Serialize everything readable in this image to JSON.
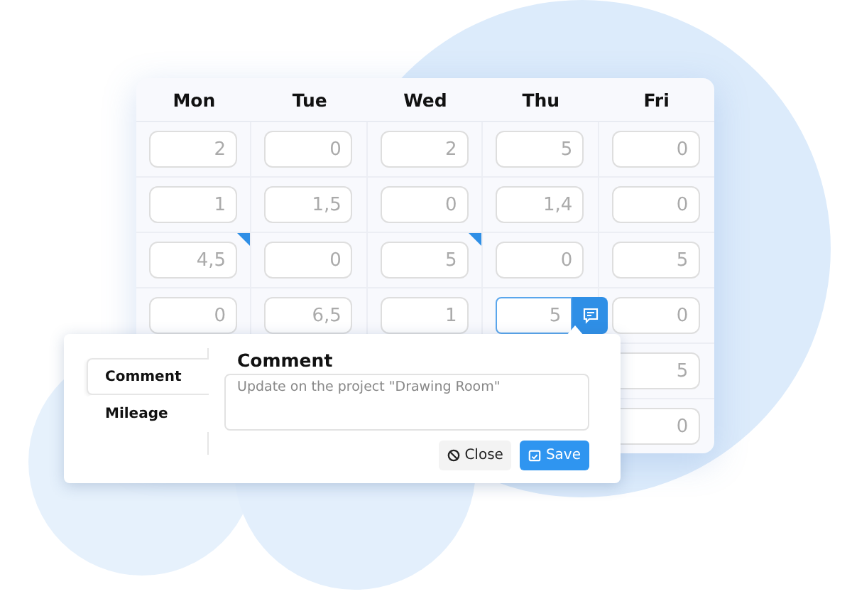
{
  "days": [
    "Mon",
    "Tue",
    "Wed",
    "Thu",
    "Fri"
  ],
  "rows": [
    {
      "cells": [
        {
          "value": "2",
          "has_comment": false,
          "active": false
        },
        {
          "value": "0",
          "has_comment": false,
          "active": false
        },
        {
          "value": "2",
          "has_comment": false,
          "active": false
        },
        {
          "value": "5",
          "has_comment": false,
          "active": false
        },
        {
          "value": "0",
          "has_comment": false,
          "active": false
        }
      ]
    },
    {
      "cells": [
        {
          "value": "1",
          "has_comment": false,
          "active": false
        },
        {
          "value": "1,5",
          "has_comment": false,
          "active": false
        },
        {
          "value": "0",
          "has_comment": false,
          "active": false
        },
        {
          "value": "1,4",
          "has_comment": false,
          "active": false
        },
        {
          "value": "0",
          "has_comment": false,
          "active": false
        }
      ]
    },
    {
      "cells": [
        {
          "value": "4,5",
          "has_comment": true,
          "active": false
        },
        {
          "value": "0",
          "has_comment": false,
          "active": false
        },
        {
          "value": "5",
          "has_comment": true,
          "active": false
        },
        {
          "value": "0",
          "has_comment": false,
          "active": false
        },
        {
          "value": "5",
          "has_comment": false,
          "active": false
        }
      ]
    },
    {
      "cells": [
        {
          "value": "0",
          "has_comment": false,
          "active": false
        },
        {
          "value": "6,5",
          "has_comment": false,
          "active": false
        },
        {
          "value": "1",
          "has_comment": false,
          "active": false
        },
        {
          "value": "5",
          "has_comment": false,
          "active": true
        },
        {
          "value": "0",
          "has_comment": false,
          "active": false
        }
      ]
    },
    {
      "cells": [
        null,
        null,
        null,
        null,
        {
          "value": "5",
          "has_comment": false,
          "active": false
        }
      ]
    },
    {
      "cells": [
        null,
        null,
        null,
        null,
        {
          "value": "0",
          "has_comment": false,
          "active": false
        }
      ]
    }
  ],
  "popup": {
    "tabs": [
      {
        "label": "Comment",
        "selected": true
      },
      {
        "label": "Mileage",
        "selected": false
      }
    ],
    "heading": "Comment",
    "comment": {
      "placeholder": "Update on the project \"Drawing Room\""
    },
    "buttons": [
      {
        "kind": "close",
        "label": "Close"
      },
      {
        "kind": "save",
        "label": "Save"
      }
    ]
  }
}
